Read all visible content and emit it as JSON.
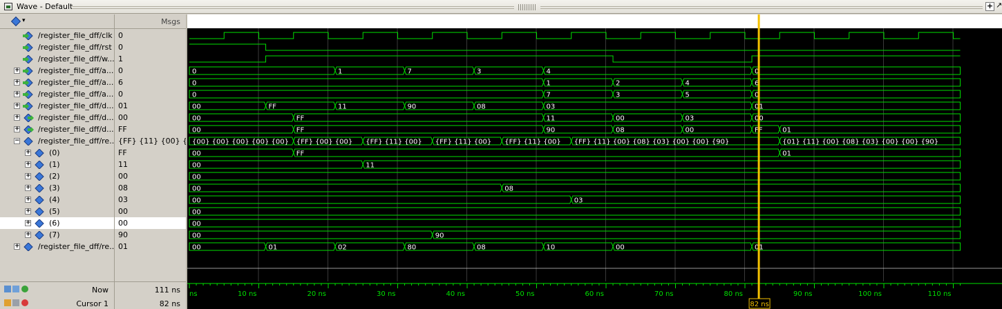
{
  "window": {
    "title": "Wave - Default",
    "maximize_label": "+",
    "float_label": "↗"
  },
  "header": {
    "msgs_label": "Msgs",
    "object_icon": "diamond-icon",
    "object_dropdown": "▾"
  },
  "signals": [
    {
      "name": "/register_file_dff/clk",
      "display": "/register_file_dff/clk",
      "value": "0",
      "kind": "in",
      "expandable": false
    },
    {
      "name": "/register_file_dff/rst",
      "display": "/register_file_dff/rst",
      "value": "0",
      "kind": "in",
      "expandable": false
    },
    {
      "name": "/register_file_dff/w",
      "display": "/register_file_dff/w...",
      "value": "1",
      "kind": "in",
      "expandable": false
    },
    {
      "name": "/register_file_dff/a",
      "display": "/register_file_dff/a...",
      "value": "0",
      "kind": "in",
      "expandable": true
    },
    {
      "name": "/register_file_dff/a",
      "display": "/register_file_dff/a...",
      "value": "6",
      "kind": "in",
      "expandable": true
    },
    {
      "name": "/register_file_dff/a",
      "display": "/register_file_dff/a...",
      "value": "0",
      "kind": "in",
      "expandable": true
    },
    {
      "name": "/register_file_dff/d",
      "display": "/register_file_dff/d...",
      "value": "01",
      "kind": "in",
      "expandable": true
    },
    {
      "name": "/register_file_dff/d",
      "display": "/register_file_dff/d...",
      "value": "00",
      "kind": "out",
      "expandable": true
    },
    {
      "name": "/register_file_dff/d",
      "display": "/register_file_dff/d...",
      "value": "FF",
      "kind": "out",
      "expandable": true
    },
    {
      "name": "/register_file_dff/re",
      "display": "/register_file_dff/re...",
      "value": "{FF} {11} {00} {...",
      "kind": "reg",
      "expandable": true,
      "expanded": true
    },
    {
      "name": "(0)",
      "display": "(0)",
      "value": "FF",
      "kind": "reg",
      "expandable": true,
      "indent": true
    },
    {
      "name": "(1)",
      "display": "(1)",
      "value": "11",
      "kind": "reg",
      "expandable": true,
      "indent": true
    },
    {
      "name": "(2)",
      "display": "(2)",
      "value": "00",
      "kind": "reg",
      "expandable": true,
      "indent": true
    },
    {
      "name": "(3)",
      "display": "(3)",
      "value": "08",
      "kind": "reg",
      "expandable": true,
      "indent": true
    },
    {
      "name": "(4)",
      "display": "(4)",
      "value": "03",
      "kind": "reg",
      "expandable": true,
      "indent": true
    },
    {
      "name": "(5)",
      "display": "(5)",
      "value": "00",
      "kind": "reg",
      "expandable": true,
      "indent": true
    },
    {
      "name": "(6)",
      "display": "(6)",
      "value": "00",
      "kind": "reg",
      "expandable": true,
      "indent": true,
      "selected": true
    },
    {
      "name": "(7)",
      "display": "(7)",
      "value": "90",
      "kind": "reg",
      "expandable": true,
      "indent": true
    },
    {
      "name": "/register_file_dff/re",
      "display": "/register_file_dff/re...",
      "value": "01",
      "kind": "reg",
      "expandable": true
    }
  ],
  "waves": {
    "clk": {
      "period_ns": 10,
      "high_first": false
    },
    "rst": [
      {
        "t": 0,
        "level": 1
      },
      {
        "t": 11,
        "level": 0
      }
    ],
    "w": [
      {
        "t": 0,
        "level": 0
      },
      {
        "t": 11,
        "level": 1
      },
      {
        "t": 61,
        "level": 0
      },
      {
        "t": 81,
        "level": 1
      }
    ],
    "bus": [
      [
        [
          "0",
          0
        ],
        [
          "1",
          21
        ],
        [
          "7",
          31
        ],
        [
          "3",
          41
        ],
        [
          "4",
          51
        ],
        [
          "0",
          81
        ]
      ],
      [
        [
          "0",
          0
        ],
        [
          "1",
          51
        ],
        [
          "2",
          61
        ],
        [
          "4",
          71
        ],
        [
          "6",
          81
        ]
      ],
      [
        [
          "0",
          0
        ],
        [
          "7",
          51
        ],
        [
          "3",
          61
        ],
        [
          "5",
          71
        ],
        [
          "0",
          81
        ]
      ],
      [
        [
          "00",
          0
        ],
        [
          "FF",
          11
        ],
        [
          "11",
          21
        ],
        [
          "90",
          31
        ],
        [
          "08",
          41
        ],
        [
          "03",
          51
        ],
        [
          "01",
          81
        ]
      ],
      [
        [
          "00",
          0
        ],
        [
          "FF",
          15
        ],
        [
          "11",
          51
        ],
        [
          "00",
          61
        ],
        [
          "03",
          71
        ],
        [
          "00",
          81
        ]
      ],
      [
        [
          "00",
          0
        ],
        [
          "FF",
          15
        ],
        [
          "90",
          51
        ],
        [
          "08",
          61
        ],
        [
          "00",
          71
        ],
        [
          "FF",
          81
        ],
        [
          "01",
          85
        ]
      ],
      [
        [
          "{00} {00} {00} {00} {00} ...",
          0
        ],
        [
          "{FF} {00} {00} ...",
          15
        ],
        [
          "{FF} {11} {00} ...",
          25
        ],
        [
          "{FF} {11} {00} ...",
          35
        ],
        [
          "{FF} {11} {00} ...",
          45
        ],
        [
          "{FF} {11} {00} {08} {03} {00} {00} {90}",
          55
        ],
        [
          "{01} {11} {00} {08} {03} {00} {00} {90}",
          85
        ]
      ],
      [
        [
          "00",
          0
        ],
        [
          "FF",
          15
        ],
        [
          "01",
          85
        ]
      ],
      [
        [
          "00",
          0
        ],
        [
          "11",
          25
        ]
      ],
      [
        [
          "00",
          0
        ]
      ],
      [
        [
          "00",
          0
        ],
        [
          "08",
          45
        ]
      ],
      [
        [
          "00",
          0
        ],
        [
          "03",
          55
        ]
      ],
      [
        [
          "00",
          0
        ]
      ],
      [
        [
          "00",
          0
        ]
      ],
      [
        [
          "00",
          0
        ],
        [
          "90",
          35
        ]
      ],
      [
        [
          "00",
          0
        ],
        [
          "01",
          11
        ],
        [
          "02",
          21
        ],
        [
          "80",
          31
        ],
        [
          "08",
          41
        ],
        [
          "10",
          51
        ],
        [
          "00",
          61
        ],
        [
          "01",
          81
        ]
      ]
    ]
  },
  "timeline": {
    "range_ns": [
      0,
      111
    ],
    "ticks": [
      "ns",
      "10 ns",
      "20 ns",
      "30 ns",
      "40 ns",
      "50 ns",
      "60 ns",
      "70 ns",
      "80 ns",
      "90 ns",
      "100 ns",
      "110 ns"
    ],
    "tick_values_ns": [
      0,
      10,
      20,
      30,
      40,
      50,
      60,
      70,
      80,
      90,
      100,
      110
    ]
  },
  "cursor": {
    "time_ns": 82,
    "label": "82 ns"
  },
  "status": {
    "now_label": "Now",
    "now_value": "111 ns",
    "cursor_label": "Cursor 1",
    "cursor_value": "82 ns"
  },
  "colors": {
    "wave": "#00e000",
    "cursor": "#f5c200",
    "grid": "#3a3a3a",
    "bg": "#000000",
    "text": "#ffffff"
  }
}
